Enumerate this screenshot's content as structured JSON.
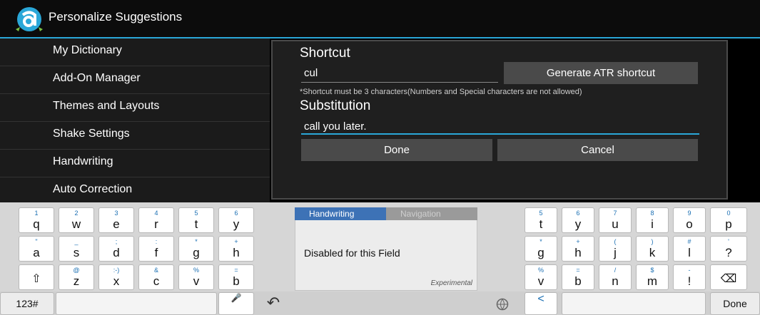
{
  "titlebar": {
    "title": "Personalize Suggestions"
  },
  "sidebar": {
    "items": [
      {
        "label": "My Dictionary"
      },
      {
        "label": "Add-On Manager"
      },
      {
        "label": "Themes and Layouts"
      },
      {
        "label": "Shake Settings"
      },
      {
        "label": "Handwriting"
      },
      {
        "label": "Auto Correction"
      }
    ]
  },
  "dialog": {
    "shortcut_label": "Shortcut",
    "shortcut_value": "cul",
    "generate_button": "Generate ATR shortcut",
    "note": "*Shortcut must be 3 characters(Numbers and Special characters are not allowed)",
    "substitution_label": "Substitution",
    "substitution_value": "call you later.",
    "done_button": "Done",
    "cancel_button": "Cancel"
  },
  "keyboard": {
    "left": {
      "row1": [
        {
          "s": "1",
          "m": "q"
        },
        {
          "s": "2",
          "m": "w"
        },
        {
          "s": "3",
          "m": "e"
        },
        {
          "s": "4",
          "m": "r"
        },
        {
          "s": "5",
          "m": "t"
        },
        {
          "s": "6",
          "m": "y"
        }
      ],
      "row2": [
        {
          "s": "\"",
          "m": "a"
        },
        {
          "s": "_",
          "m": "s"
        },
        {
          "s": ";",
          "m": "d"
        },
        {
          "s": ":",
          "m": "f"
        },
        {
          "s": "*",
          "m": "g"
        },
        {
          "s": "+",
          "m": "h"
        }
      ],
      "row3": [
        {
          "s": "@",
          "m": "z"
        },
        {
          "s": ":-)",
          "m": "x"
        },
        {
          "s": "&",
          "m": "c"
        },
        {
          "s": "%",
          "m": "v"
        },
        {
          "s": "=",
          "m": "b"
        }
      ]
    },
    "right": {
      "row1": [
        {
          "s": "5",
          "m": "t"
        },
        {
          "s": "6",
          "m": "y"
        },
        {
          "s": "7",
          "m": "u"
        },
        {
          "s": "8",
          "m": "i"
        },
        {
          "s": "9",
          "m": "o"
        },
        {
          "s": "0",
          "m": "p"
        }
      ],
      "row2": [
        {
          "s": "*",
          "m": "g"
        },
        {
          "s": "+",
          "m": "h"
        },
        {
          "s": "(",
          "m": "j"
        },
        {
          "s": ")",
          "m": "k"
        },
        {
          "s": "#",
          "m": "l"
        },
        {
          "s": "'",
          "m": "?"
        }
      ],
      "row3": [
        {
          "s": "%",
          "m": "v"
        },
        {
          "s": "=",
          "m": "b"
        },
        {
          "s": "/",
          "m": "n"
        },
        {
          "s": "$",
          "m": "m"
        },
        {
          "s": "-",
          "m": "!"
        }
      ]
    },
    "shift_glyph": "⇧",
    "backspace_glyph": "⌫",
    "numbers_key": "123#",
    "done_key": "Done",
    "undo_glyph": "↶",
    "mic_glyph": "🎤",
    "share_glyph": "<",
    "handwriting": {
      "tab_handwriting": "Handwriting",
      "tab_navigation": "Navigation",
      "message": "Disabled for this Field",
      "experimental": "Experimental"
    }
  },
  "colors": {
    "accent": "#2aa7d8",
    "tab_active": "#3d72b6"
  }
}
